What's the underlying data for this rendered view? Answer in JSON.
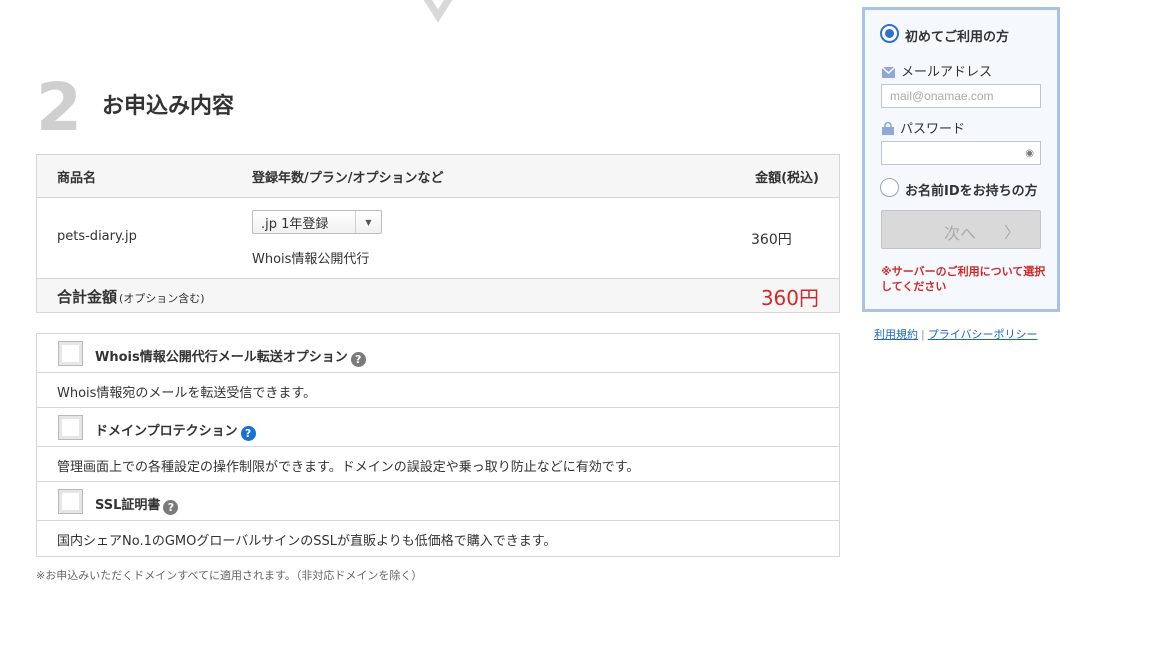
{
  "section": {
    "number": "2",
    "title": "お申込み内容"
  },
  "order_table": {
    "headers": {
      "product": "商品名",
      "plan": "登録年数/プラン/オプションなど",
      "price": "金額(税込)"
    },
    "row": {
      "domain": "pets-diary.jp",
      "plan_select": ".jp 1年登録",
      "option": "Whois情報公開代行",
      "price": "360円"
    },
    "total": {
      "label": "合計金額",
      "sub": "(オプション含む)",
      "value": "360円"
    }
  },
  "options": [
    {
      "label": "Whois情報公開代行メール転送オプション",
      "help": "?",
      "checked": false,
      "desc": "Whois情報宛のメールを転送受信できます。"
    },
    {
      "label": "ドメインプロテクション",
      "help": "?",
      "checked": false,
      "desc": "管理画面上での各種設定の操作制限ができます。ドメインの誤設定や乗っ取り防止などに有効です。"
    },
    {
      "label": "SSL証明書",
      "help": "?",
      "checked": false,
      "desc": "国内シェアNo.1のGMOグローバルサインのSSLが直販よりも低価格で購入できます。"
    }
  ],
  "footnote": "※お申込みいただくドメインすべてに適用されます。（非対応ドメインを除く）",
  "login_panel": {
    "first_time_label": "初めてご利用の方",
    "email_label": "メールアドレス",
    "email_placeholder": "mail@onamae.com",
    "password_label": "パスワード",
    "has_id_label": "お名前IDをお持ちの方",
    "next_button": "次へ",
    "next_arrow": "〉",
    "warning": "※サーバーのご利用について選択してください"
  },
  "links": {
    "terms": "利用規約",
    "separator": "|",
    "privacy": "プライバシーポリシー"
  },
  "colors": {
    "accent_blue": "#2f6fd6",
    "price_red": "#d32828",
    "panel_border": "#a9c2e6"
  }
}
